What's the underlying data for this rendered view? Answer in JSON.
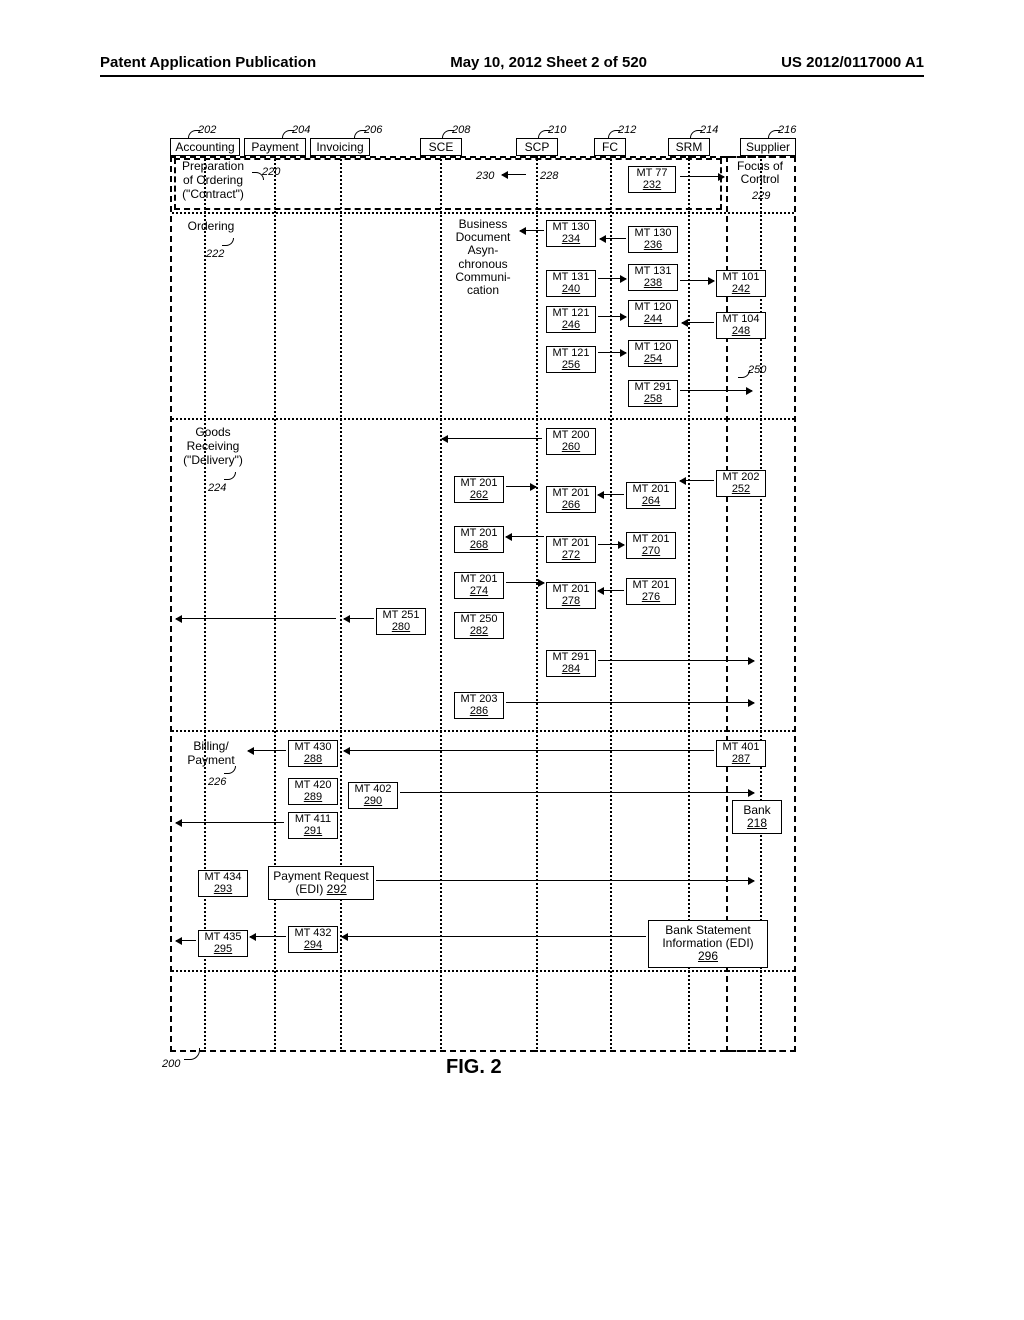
{
  "header": {
    "left": "Patent Application Publication",
    "center": "May 10, 2012  Sheet 2 of 520",
    "right": "US 2012/0117000 A1"
  },
  "columns": [
    {
      "label": "Accounting",
      "ref": "202"
    },
    {
      "label": "Payment",
      "ref": "204"
    },
    {
      "label": "Invoicing",
      "ref": "206"
    },
    {
      "label": "SCE",
      "ref": "208"
    },
    {
      "label": "SCP",
      "ref": "210"
    },
    {
      "label": "FC",
      "ref": "212"
    },
    {
      "label": "SRM",
      "ref": "214"
    },
    {
      "label": "Supplier",
      "ref": "216"
    }
  ],
  "rows": [
    {
      "label": "Preparation\nof Ordering\n(\"Contract\")",
      "ref": "220"
    },
    {
      "label": "Ordering",
      "ref": "222"
    },
    {
      "label": "Goods\nReceiving\n(\"Delivery\")",
      "ref": "224"
    },
    {
      "label": "Billing/\nPayment",
      "ref": "226"
    }
  ],
  "notes": {
    "bdac": "Business\nDocument\nAsyn-\nchronous\nCommuni-\ncation",
    "focus": "Focus of\nControl",
    "focus_ref": "229",
    "arrow228": "228",
    "arrow230": "230",
    "ref250": "250",
    "ref200": "200"
  },
  "messages": {
    "mt77": {
      "t": "MT 77",
      "r": "232"
    },
    "mt130a": {
      "t": "MT 130",
      "r": "234"
    },
    "mt130b": {
      "t": "MT 130",
      "r": "236"
    },
    "mt131a": {
      "t": "MT 131",
      "r": "240"
    },
    "mt131b": {
      "t": "MT 131",
      "r": "238"
    },
    "mt101": {
      "t": "MT 101",
      "r": "242"
    },
    "mt121a": {
      "t": "MT 121",
      "r": "246"
    },
    "mt120a": {
      "t": "MT 120",
      "r": "244"
    },
    "mt104": {
      "t": "MT 104",
      "r": "248"
    },
    "mt121b": {
      "t": "MT 121",
      "r": "256"
    },
    "mt120b": {
      "t": "MT 120",
      "r": "254"
    },
    "mt291a": {
      "t": "MT 291",
      "r": "258"
    },
    "mt200": {
      "t": "MT 200",
      "r": "260"
    },
    "mt201a": {
      "t": "MT 201",
      "r": "262"
    },
    "mt201b": {
      "t": "MT 201",
      "r": "266"
    },
    "mt201c": {
      "t": "MT 201",
      "r": "264"
    },
    "mt202": {
      "t": "MT 202",
      "r": "252"
    },
    "mt201d": {
      "t": "MT 201",
      "r": "268"
    },
    "mt201e": {
      "t": "MT 201",
      "r": "272"
    },
    "mt201f": {
      "t": "MT 201",
      "r": "270"
    },
    "mt201g": {
      "t": "MT 201",
      "r": "274"
    },
    "mt201h": {
      "t": "MT 201",
      "r": "278"
    },
    "mt201i": {
      "t": "MT 201",
      "r": "276"
    },
    "mt251": {
      "t": "MT 251",
      "r": "280"
    },
    "mt250": {
      "t": "MT 250",
      "r": "282"
    },
    "mt291b": {
      "t": "MT 291",
      "r": "284"
    },
    "mt203": {
      "t": "MT 203",
      "r": "286"
    },
    "mt430": {
      "t": "MT 430",
      "r": "288"
    },
    "mt401": {
      "t": "MT 401",
      "r": "287"
    },
    "mt420": {
      "t": "MT 420",
      "r": "289"
    },
    "mt402": {
      "t": "MT 402",
      "r": "290"
    },
    "mt411": {
      "t": "MT 411",
      "r": "291"
    },
    "mt434": {
      "t": "MT 434",
      "r": "293"
    },
    "mt432": {
      "t": "MT 432",
      "r": "294"
    },
    "mt435": {
      "t": "MT 435",
      "r": "295"
    }
  },
  "extboxes": {
    "bank": {
      "t": "Bank",
      "r": "218"
    },
    "payreq": {
      "t": "Payment Request\n(EDI)",
      "r": "292"
    },
    "bankstmt": {
      "t": "Bank Statement\nInformation (EDI)",
      "r": "296"
    }
  },
  "figure": "FIG. 2"
}
